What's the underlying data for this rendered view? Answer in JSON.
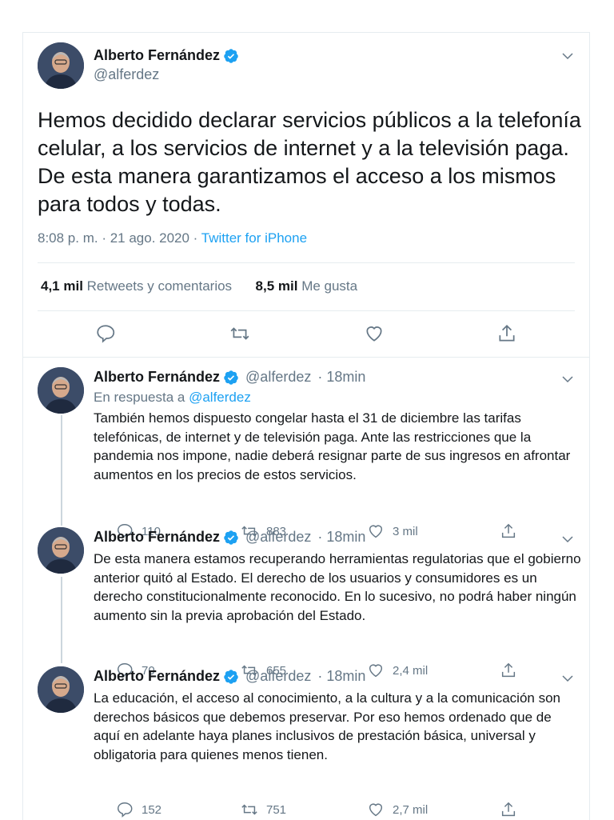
{
  "main_tweet": {
    "author_name": "Alberto Fernández",
    "handle": "@alferdez",
    "text": "Hemos decidido declarar servicios públicos a la telefonía celular, a los servicios de internet y a la televisión paga. De esta manera garantizamos el acceso a los mismos para todos y todas.",
    "time": "8:08 p. m. · 21 ago. 2020 · ",
    "source": "Twitter for iPhone",
    "retweets_count": "4,1 mil",
    "retweets_label": "Retweets y comentarios",
    "likes_count": "8,5 mil",
    "likes_label": "Me gusta",
    "icons": [
      "reply-icon",
      "retweet-icon",
      "like-icon",
      "share-icon"
    ]
  },
  "replies": [
    {
      "author_name": "Alberto Fernández",
      "handle": "@alferdez",
      "time": "· 18min",
      "reply_to_prefix": "En respuesta a",
      "reply_to_handle": "@alferdez",
      "text": "También hemos dispuesto congelar hasta el 31 de diciembre las tarifas telefónicas, de internet y de televisión paga. Ante las restricciones que la pandemia nos impone, nadie deberá resignar parte de sus ingresos en afrontar aumentos en los precios de estos servicios.",
      "replies": "110",
      "retweets": "883",
      "likes": "3 mil"
    },
    {
      "author_name": "Alberto Fernández",
      "handle": "@alferdez",
      "time": "· 18min",
      "text": "De esta manera estamos recuperando herramientas regulatorias que el gobierno anterior quitó al Estado. El derecho de los usuarios y consumidores es un derecho constitucionalmente reconocido. En lo sucesivo, no podrá haber ningún aumento sin la previa aprobación del Estado.",
      "replies": "70",
      "retweets": "655",
      "likes": "2,4 mil"
    },
    {
      "author_name": "Alberto Fernández",
      "handle": "@alferdez",
      "time": "· 18min",
      "text": "La educación, el acceso al conocimiento, a la cultura y a la comunicación son derechos básicos que debemos preservar. Por eso hemos ordenado que de aquí en adelante haya planes inclusivos de prestación básica, universal y obligatoria para quienes menos tienen.",
      "replies": "152",
      "retweets": "751",
      "likes": "2,7 mil"
    }
  ],
  "colors": {
    "accent": "#1da1f2",
    "text": "#14171a",
    "muted": "#657786",
    "border": "#e6ecf0"
  }
}
